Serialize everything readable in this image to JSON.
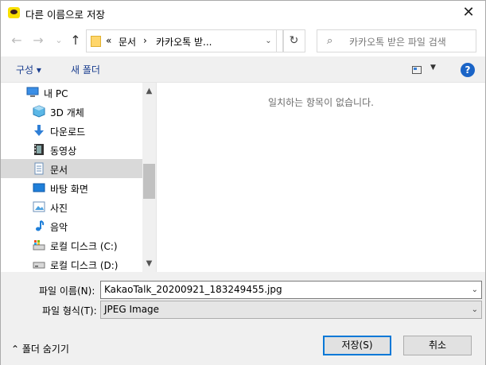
{
  "window": {
    "title": "다른 이름으로 저장",
    "close_glyph": "✕"
  },
  "nav": {
    "back_glyph": "←",
    "forward_glyph": "→",
    "recent_glyph": "⌄",
    "up_glyph": "↑",
    "breadcrumb": [
      "«",
      "문서",
      "›",
      "카카오톡 받..."
    ],
    "address_dropdown_glyph": "⌄",
    "refresh_glyph": "↻",
    "search_icon_glyph": "⌕",
    "search_placeholder": "카카오톡 받은 파일 검색"
  },
  "toolbar": {
    "organize_label": "구성 ▾",
    "new_folder_label": "새 폴더",
    "view_dropdown_glyph": "▼",
    "help_glyph": "?"
  },
  "tree": {
    "items": [
      {
        "label": "내 PC",
        "icon": "pc-icon"
      },
      {
        "label": "3D 개체",
        "icon": "3d-objects-icon"
      },
      {
        "label": "다운로드",
        "icon": "download-icon"
      },
      {
        "label": "동영상",
        "icon": "video-icon"
      },
      {
        "label": "문서",
        "icon": "document-icon",
        "selected": true
      },
      {
        "label": "바탕 화면",
        "icon": "desktop-icon"
      },
      {
        "label": "사진",
        "icon": "pictures-icon"
      },
      {
        "label": "음악",
        "icon": "music-icon"
      },
      {
        "label": "로컬 디스크 (C:)",
        "icon": "drive-c-icon"
      },
      {
        "label": "로컬 디스크 (D:)",
        "icon": "drive-d-icon"
      }
    ],
    "scroll_up_glyph": "▲",
    "scroll_down_glyph": "▼"
  },
  "content": {
    "empty_message": "일치하는 항목이 없습니다."
  },
  "form": {
    "filename_label": "파일 이름(N):",
    "filename_value": "KakaoTalk_20200921_183249455.jpg",
    "filetype_label": "파일 형식(T):",
    "filetype_value": "JPEG Image",
    "dropdown_glyph": "⌄",
    "hide_folders_label": "⌃  폴더 숨기기",
    "save_label": "저장(S)",
    "cancel_label": "취소"
  },
  "colors": {
    "accent": "#0078d7",
    "link_blue": "#1a3e8f",
    "selection": "#d9d9d9"
  }
}
